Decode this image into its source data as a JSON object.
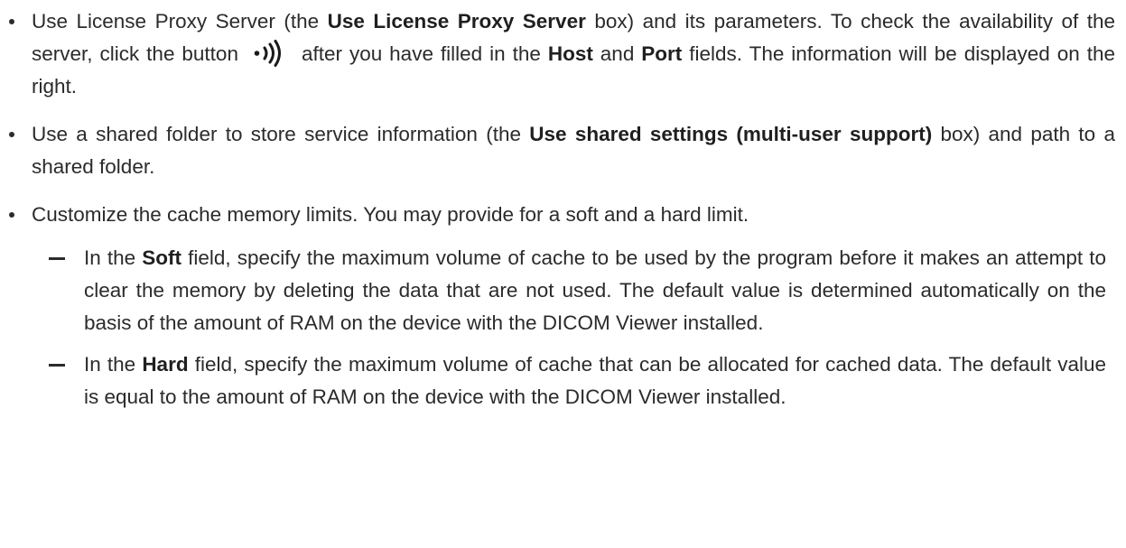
{
  "items": [
    {
      "t1": "Use License Proxy Server (the ",
      "b1": "Use License Proxy Server",
      "t2": " box) and its parameters.  To check the availability of the server, click the button",
      "icon": "wireless-signal-icon",
      "t3": "after you have filled in the ",
      "b2": "Host",
      "t4": " and ",
      "b3": "Port",
      "t5": " fields. The information will be displayed on the right."
    },
    {
      "t1": "Use a shared folder to store service information (the ",
      "b1": "Use shared settings (multi-user support)",
      "t2": " box) and path to a shared folder."
    },
    {
      "t1": "Customize the cache memory limits. You may provide for a soft and a hard limit.",
      "subitems": [
        {
          "t1": "In the ",
          "b1": "Soft",
          "t2": " field, specify the maximum volume of cache to be used by the program before it makes an attempt to clear the memory by deleting the data that are not used. The default value is determined automatically on the basis of the amount of RAM on the device with the DICOM Viewer installed."
        },
        {
          "t1": "In the ",
          "b1": "Hard",
          "t2": " field, specify the maximum volume of cache that can be allocated for cached data. The default value is equal to the amount of RAM on the device with the DICOM Viewer installed."
        }
      ]
    }
  ]
}
